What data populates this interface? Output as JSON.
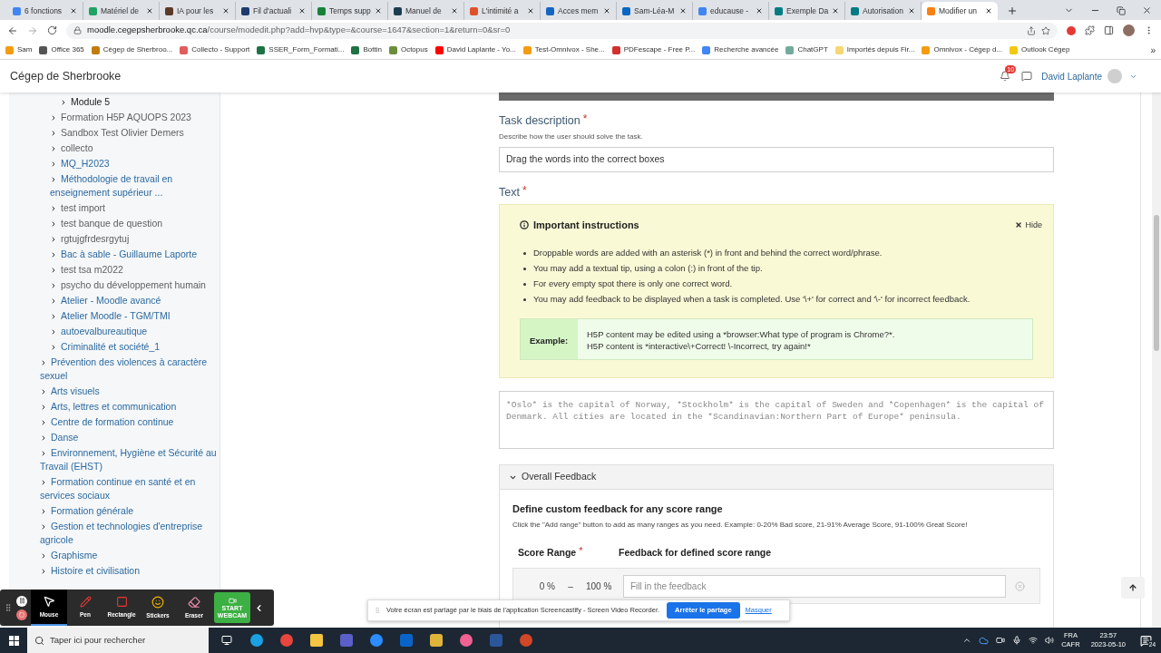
{
  "browser": {
    "tabs": [
      {
        "title": "6 fonctions",
        "color": "#4285f4",
        "selected": false
      },
      {
        "title": "Matériel de",
        "color": "#1fa463",
        "selected": false
      },
      {
        "title": "IA pour les",
        "color": "#5b3a29",
        "selected": false
      },
      {
        "title": "Fil d'actuali",
        "color": "#1e3a6e",
        "selected": false
      },
      {
        "title": "Temps supp",
        "color": "#188038",
        "selected": false
      },
      {
        "title": "Manuel de",
        "color": "#1b3d4f",
        "selected": false
      },
      {
        "title": "L'intimité a",
        "color": "#e0502a",
        "selected": false
      },
      {
        "title": "Acces mem",
        "color": "#1565c0",
        "selected": false
      },
      {
        "title": "Sam-Léa-M",
        "color": "#0a66c2",
        "selected": false
      },
      {
        "title": "educause -",
        "color": "#4285f4",
        "selected": false
      },
      {
        "title": "Exemple Da",
        "color": "#037b83",
        "selected": false
      },
      {
        "title": "Autorisation",
        "color": "#037b83",
        "selected": false
      },
      {
        "title": "Modifier un",
        "color": "#f98012",
        "selected": true
      }
    ],
    "url_host": "moodle.cegepsherbrooke.qc.ca",
    "url_path": "/course/modedit.php?add=hvp&type=&course=1647&section=1&return=0&sr=0",
    "bookmarks": [
      {
        "label": "Sam",
        "color": "#f39c12"
      },
      {
        "label": "Office 365",
        "color": "#555555"
      },
      {
        "label": "Cégep de Sherbroo...",
        "color": "#c27c0e"
      },
      {
        "label": "Collecto - Support",
        "color": "#e25d5d"
      },
      {
        "label": "SSER_Form_Formati...",
        "color": "#1e7145"
      },
      {
        "label": "Bottin",
        "color": "#1e7145"
      },
      {
        "label": "Octopus",
        "color": "#6a8f3a"
      },
      {
        "label": "David Laplante - Yo...",
        "color": "#ff0000"
      },
      {
        "label": "Test-Omnivox - She...",
        "color": "#f39c12"
      },
      {
        "label": "PDFescape - Free P...",
        "color": "#d32f2f"
      },
      {
        "label": "Recherche avancée",
        "color": "#4285f4"
      },
      {
        "label": "ChatGPT",
        "color": "#74aa9c"
      },
      {
        "label": "Importés depuis Fir...",
        "color": "#f7d774"
      },
      {
        "label": "Omnivox - Cégep d...",
        "color": "#f39c12"
      },
      {
        "label": "Outlook Cégep",
        "color": "#f2c811"
      }
    ],
    "bookmarks_more": "»"
  },
  "site": {
    "title": "Cégep de Sherbrooke",
    "notifications": "10",
    "user": "David Laplante"
  },
  "sidebar": {
    "items": [
      {
        "children": [
          {
            "children": [
              {
                "label": "Module 5",
                "kind": "current"
              }
            ]
          },
          {
            "label": "Formation H5P AQUOPS 2023",
            "kind": "muted"
          },
          {
            "label": "Sandbox Test Olivier Demers",
            "kind": "muted"
          },
          {
            "label": "collecto",
            "kind": "muted"
          },
          {
            "label": "MQ_H2023",
            "kind": "link"
          },
          {
            "label": "Méthodologie de travail en enseignement supérieur ...",
            "kind": "link"
          },
          {
            "label": "test import",
            "kind": "muted"
          },
          {
            "label": "test banque de question",
            "kind": "muted"
          },
          {
            "label": "rgtujgfrdesrgytuj",
            "kind": "muted"
          },
          {
            "label": "Bac à sable - Guillaume Laporte",
            "kind": "link"
          },
          {
            "label": "test tsa m2022",
            "kind": "muted"
          },
          {
            "label": "psycho du développement humain",
            "kind": "muted"
          },
          {
            "label": "Atelier - Moodle avancé",
            "kind": "link"
          },
          {
            "label": "Atelier Moodle - TGM/TMI",
            "kind": "link"
          },
          {
            "label": "autoevalbureautique",
            "kind": "link"
          },
          {
            "label": "Criminalité et société_1",
            "kind": "link"
          }
        ]
      },
      {
        "label": "Prévention des violences à caractère sexuel",
        "kind": "link"
      },
      {
        "label": "Arts visuels",
        "kind": "link"
      },
      {
        "label": "Arts, lettres et communication",
        "kind": "link"
      },
      {
        "label": "Centre de formation continue",
        "kind": "link"
      },
      {
        "label": "Danse",
        "kind": "link"
      },
      {
        "label": "Environnement, Hygiène et Sécurité au Travail (EHST)",
        "kind": "link"
      },
      {
        "label": "Formation continue en santé et en services sociaux",
        "kind": "link"
      },
      {
        "label": "Formation générale",
        "kind": "link"
      },
      {
        "label": "Gestion et technologies d'entreprise agricole",
        "kind": "link"
      },
      {
        "label": "Graphisme",
        "kind": "link"
      },
      {
        "label": "Histoire et civilisation",
        "kind": "link"
      }
    ]
  },
  "form": {
    "task_description": {
      "label": "Task description",
      "required": "*",
      "hint": "Describe how the user should solve the task.",
      "value": "Drag the words into the correct boxes"
    },
    "text_field": {
      "label": "Text",
      "required": "*",
      "instructions": {
        "title": "Important instructions",
        "hide": "Hide",
        "bullets": [
          "Droppable words are added with an asterisk (*) in front and behind the correct word/phrase.",
          "You may add a textual tip, using a colon (:) in front of the tip.",
          "For every empty spot there is only one correct word.",
          "You may add feedback to be displayed when a task is completed. Use '\\+' for correct and '\\-' for incorrect feedback."
        ],
        "example_label": "Example:",
        "example_lines": [
          "H5P content may be edited using a *browser:What type of program is Chrome?*.",
          "H5P content is *interactive\\+Correct! \\-Incorrect, try again!*"
        ]
      },
      "placeholder": "*Oslo* is the capital of Norway, *Stockholm* is the capital of Sweden and *Copenhagen* is the capital of Denmark. All cities are located in the *Scandinavian:Northern Part of Europe* peninsula."
    },
    "overall_feedback": {
      "title": "Overall Feedback",
      "expanded": true,
      "heading": "Define custom feedback for any score range",
      "hint": "Click the \"Add range\" button to add as many ranges as you need. Example: 0-20% Bad score, 21-91% Average Score, 91-100% Great Score!",
      "columns": [
        {
          "label": "Score Range",
          "required": "*"
        },
        {
          "label": "Feedback for defined score range"
        }
      ],
      "ranges": [
        {
          "from": "0 %",
          "separator": "–",
          "to": "100 %",
          "placeholder": "Fill in the feedback"
        }
      ]
    }
  },
  "recorder": {
    "tools": [
      {
        "label": "Mouse",
        "kind": "mouse",
        "selected": true
      },
      {
        "label": "Pen",
        "kind": "pen",
        "selected": false
      },
      {
        "label": "Rectangle",
        "kind": "rectangle",
        "selected": false
      },
      {
        "label": "Stickers",
        "kind": "stickers",
        "selected": false
      },
      {
        "label": "Eraser",
        "kind": "eraser",
        "selected": false
      }
    ],
    "webcam": "START WEBCAM"
  },
  "share_banner": {
    "message": "Votre écran est partagé par le biais de l'application Screencastify - Screen Video Recorder.",
    "stop": "Arrêter le partage",
    "hide": "Masquer"
  },
  "taskbar": {
    "search_placeholder": "Taper ici pour rechercher",
    "language": "FRA",
    "layout": "CAFR",
    "time": "23:57",
    "date": "2023-05-10",
    "notifications": "24"
  }
}
